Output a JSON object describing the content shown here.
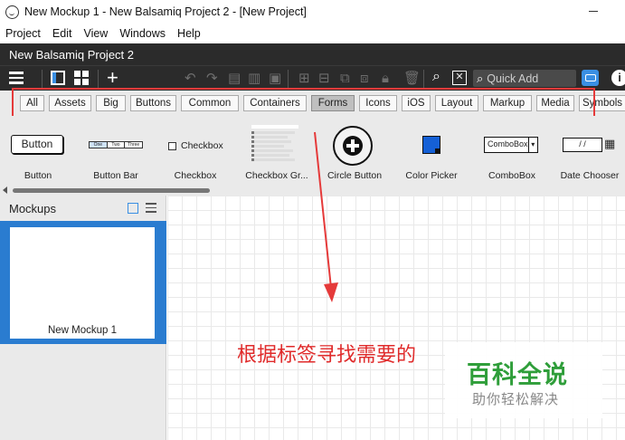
{
  "window": {
    "title": "New Mockup 1 - New Balsamiq Project 2 - [New Project]"
  },
  "menu": [
    "Project",
    "Edit",
    "View",
    "Windows",
    "Help"
  ],
  "project": {
    "name": "New Balsamiq Project 2"
  },
  "toolbar": {
    "quick_add_placeholder": "Quick Add"
  },
  "categories": [
    "All",
    "Assets",
    "Big",
    "Buttons",
    "Common",
    "Containers",
    "Forms",
    "Icons",
    "iOS",
    "Layout",
    "Markup",
    "Media",
    "Symbols"
  ],
  "active_category": "Forms",
  "library": {
    "items": [
      "Button",
      "Button Bar",
      "Checkbox",
      "Checkbox Gr...",
      "Circle Button",
      "Color Picker",
      "ComboBox",
      "Date Chooser"
    ],
    "button_preview": "Button",
    "buttonbar_segments": [
      "One",
      "Two",
      "Three"
    ],
    "checkbox_preview": "Checkbox",
    "combobox_preview": "ComboBox",
    "date_preview": "/ /"
  },
  "mockups_panel": {
    "title": "Mockups",
    "items": [
      {
        "name": "New Mockup 1",
        "selected": true
      }
    ]
  },
  "annotation": {
    "text": "根据标签寻找需要的"
  },
  "watermark": {
    "title": "百科全说",
    "subtitle": "助你轻松解决"
  },
  "colors": {
    "accent_blue": "#2a7cd0",
    "annotation_red": "#e53a3a",
    "toolbar_bg": "#2b2b2b",
    "watermark_green": "#2f9e3a"
  }
}
